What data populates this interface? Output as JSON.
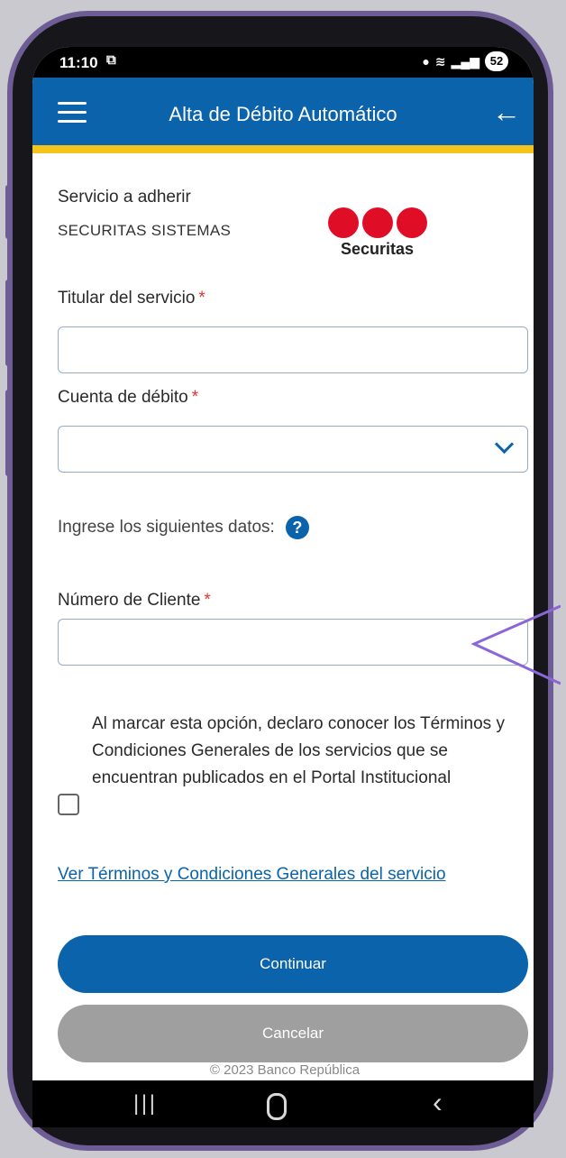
{
  "status": {
    "time": "11:10",
    "battery": "52"
  },
  "appbar": {
    "title": "Alta de Débito Automático"
  },
  "service": {
    "label": "Servicio a adherir",
    "name": "SECURITAS SISTEMAS",
    "logo_text": "Securitas"
  },
  "form": {
    "holder_label": "Titular del servicio",
    "holder_value": "",
    "account_label": "Cuenta de débito",
    "account_value": "",
    "required_mark": "*",
    "data_hint": "Ingrese los siguientes datos:",
    "help_symbol": "?",
    "client_label": "Número de Cliente",
    "client_value": ""
  },
  "terms": {
    "checkbox_text": "Al marcar esta opción, declaro conocer los Términos y Condiciones Generales de los servicios que se encuentran publicados en el Portal Institucional",
    "checked": false,
    "link_text": "Ver Términos y Condiciones Generales del servicio"
  },
  "actions": {
    "continue_label": "Continuar",
    "cancel_label": "Cancelar"
  },
  "footer": {
    "text": "© 2023 Banco República"
  },
  "colors": {
    "brand_blue": "#0a63ab",
    "accent_yellow": "#f4c41c",
    "required_red": "#e0352b",
    "logo_red": "#e00d26",
    "cancel_gray": "#9f9f9f",
    "phone_frame": "#6e5c95"
  }
}
